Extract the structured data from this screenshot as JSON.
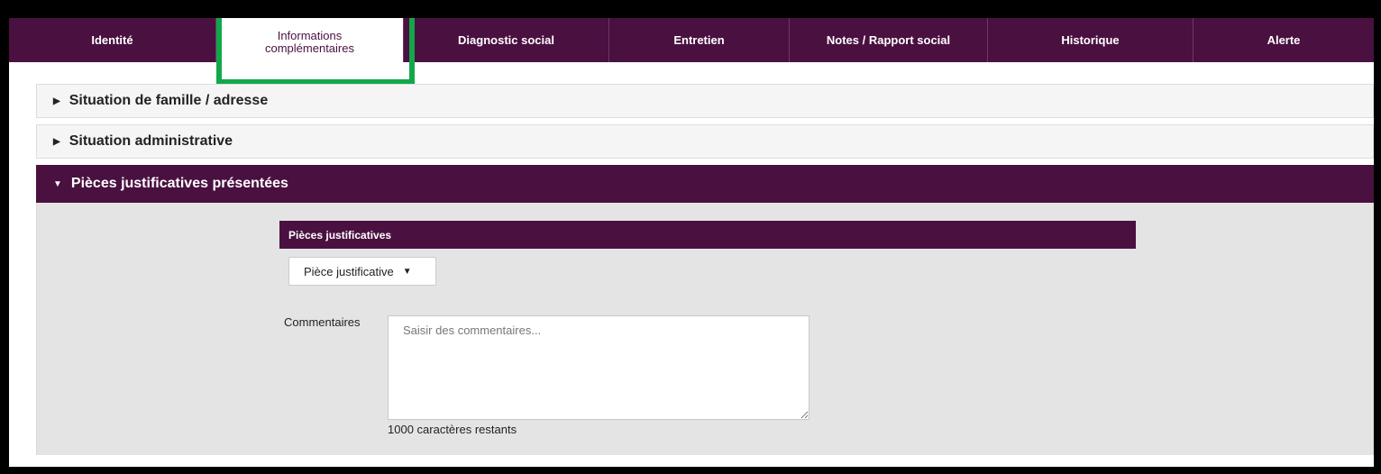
{
  "tabs": [
    {
      "label": "Identité"
    },
    {
      "label": "Informations\ncomplémentaires"
    },
    {
      "label": "Diagnostic social"
    },
    {
      "label": "Entretien"
    },
    {
      "label": "Notes / Rapport social"
    },
    {
      "label": "Historique"
    },
    {
      "label": "Alerte"
    }
  ],
  "active_tab": "Informations complémentaires",
  "accordion": {
    "sections": [
      {
        "title": "Situation de famille / adresse",
        "state": "collapsed"
      },
      {
        "title": "Situation administrative",
        "state": "collapsed"
      },
      {
        "title": "Pièces justificatives présentées",
        "state": "expanded"
      }
    ]
  },
  "documents": {
    "header": "Pièces justificatives",
    "dropdown_label": "Pièce justificative",
    "comment_label": "Commentaires",
    "comment_placeholder": "Saisir des commentaires...",
    "comment_value": "",
    "chars_remaining": "1000 caractères restants"
  },
  "colors": {
    "brand": "#4a1040",
    "highlight": "#12a84a",
    "panel_bg": "#e4e4e4"
  },
  "icons": {
    "collapsed": "caret-right-icon",
    "expanded": "caret-down-icon",
    "dropdown": "caret-down-icon"
  }
}
